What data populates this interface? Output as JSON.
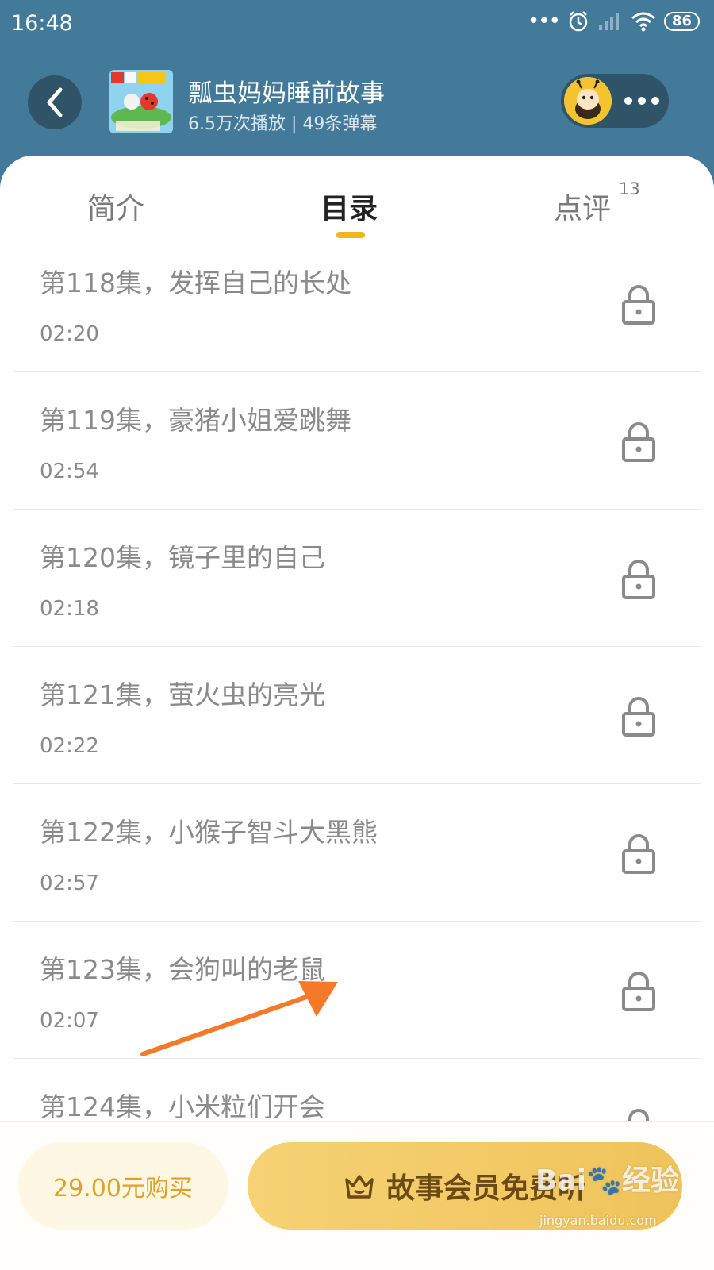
{
  "status_bar": {
    "time": "16:48",
    "dots": "•••",
    "battery": "86"
  },
  "header": {
    "title": "瓢虫妈妈睡前故事",
    "subtitle": "6.5万次播放 | 49条弹幕",
    "cover_text": "瓢虫妈妈睡前故事"
  },
  "tabs": [
    {
      "label": "简介"
    },
    {
      "label": "目录",
      "active": true
    },
    {
      "label": "点评",
      "count": "13"
    }
  ],
  "episodes": [
    {
      "title": "第118集，发挥自己的长处",
      "duration": "02:20",
      "locked": true
    },
    {
      "title": "第119集，豪猪小姐爱跳舞",
      "duration": "02:54",
      "locked": true
    },
    {
      "title": "第120集，镜子里的自己",
      "duration": "02:18",
      "locked": true
    },
    {
      "title": "第121集，萤火虫的亮光",
      "duration": "02:22",
      "locked": true
    },
    {
      "title": "第122集，小猴子智斗大黑熊",
      "duration": "02:57",
      "locked": true
    },
    {
      "title": "第123集，会狗叫的老鼠",
      "duration": "02:07",
      "locked": true
    },
    {
      "title": "第124集，小米粒们开会",
      "duration": "",
      "locked": true
    }
  ],
  "bottom_bar": {
    "buy_label": "29.00元购买",
    "member_label": "故事会员免费听"
  },
  "watermark": {
    "text": "Bai🐾经验",
    "sub": "jingyan.baidu.com"
  },
  "colors": {
    "header_bg": "#437a99",
    "accent": "#f5b320",
    "member_button": "#f3cc68",
    "annotation_arrow": "#f47a2a"
  }
}
